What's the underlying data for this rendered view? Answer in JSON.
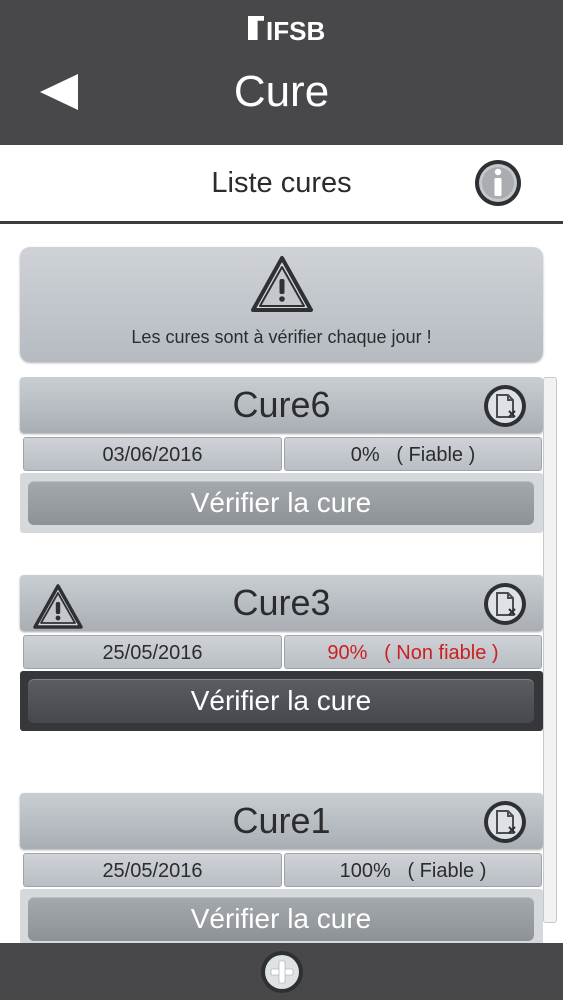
{
  "header": {
    "logo_text": "IFSB",
    "title": "Cure",
    "back_icon": "back-arrow-icon"
  },
  "subheader": {
    "title": "Liste cures",
    "info_icon": "info-icon"
  },
  "warning": {
    "icon": "warning-triangle-icon",
    "text": "Les cures sont à vérifier chaque jour !"
  },
  "cures": [
    {
      "name": "Cure6",
      "date": "03/06/2016",
      "percent": "0%",
      "status": "( Fiable )",
      "reliable": true,
      "warning": false,
      "verify_label": "Vérifier la cure"
    },
    {
      "name": "Cure3",
      "date": "25/05/2016",
      "percent": "90%",
      "status": "( Non fiable )",
      "reliable": false,
      "warning": true,
      "verify_label": "Vérifier la cure"
    },
    {
      "name": "Cure1",
      "date": "25/05/2016",
      "percent": "100%",
      "status": "( Fiable )",
      "reliable": true,
      "warning": false,
      "verify_label": "Vérifier la cure"
    }
  ],
  "footer": {
    "add_icon": "plus-icon"
  },
  "colors": {
    "header_bg": "#48484a",
    "unreliable_text": "#cc1f1f"
  }
}
